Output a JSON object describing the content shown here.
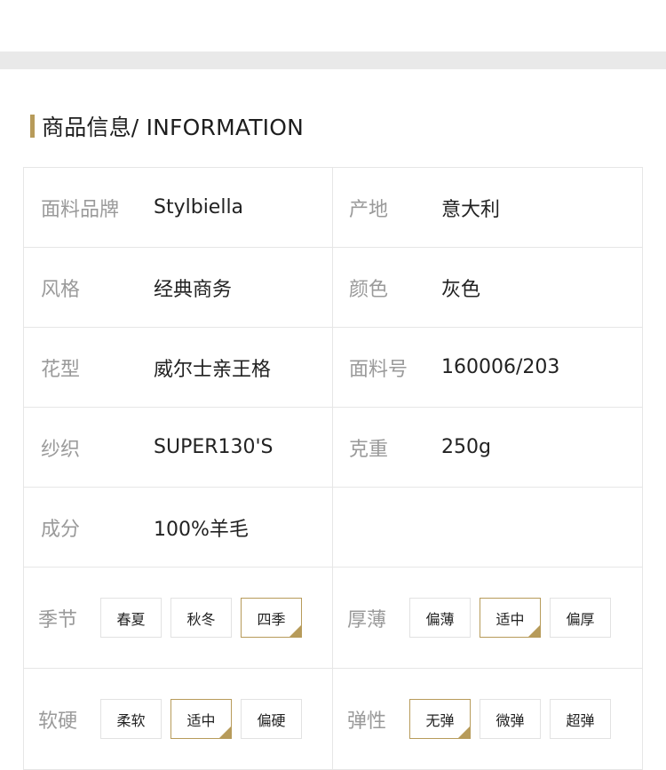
{
  "section": {
    "title": "商品信息/ INFORMATION"
  },
  "colors": {
    "accent": "#b79b5a",
    "label": "#9a9a9a",
    "border": "#e6e6e6",
    "topbar": "#e9e9e9"
  },
  "rows": [
    {
      "left": {
        "label": "面料品牌",
        "value": "Stylbiella"
      },
      "right": {
        "label": "产地",
        "value": "意大利"
      }
    },
    {
      "left": {
        "label": "风格",
        "value": "经典商务"
      },
      "right": {
        "label": "颜色",
        "value": "灰色"
      }
    },
    {
      "left": {
        "label": "花型",
        "value": "威尔士亲王格"
      },
      "right": {
        "label": "面料号",
        "value": "160006/203"
      }
    },
    {
      "left": {
        "label": "纱织",
        "value": "SUPER130'S"
      },
      "right": {
        "label": "克重",
        "value": "250g"
      }
    },
    {
      "left": {
        "label": "成分",
        "value": "100%羊毛"
      }
    }
  ],
  "options": [
    {
      "left": {
        "label": "季节",
        "choices": [
          "春夏",
          "秋冬",
          "四季"
        ],
        "selected": "四季"
      },
      "right": {
        "label": "厚薄",
        "choices": [
          "偏薄",
          "适中",
          "偏厚"
        ],
        "selected": "适中"
      }
    },
    {
      "left": {
        "label": "软硬",
        "choices": [
          "柔软",
          "适中",
          "偏硬"
        ],
        "selected": "适中"
      },
      "right": {
        "label": "弹性",
        "choices": [
          "无弹",
          "微弹",
          "超弹"
        ],
        "selected": "无弹"
      }
    }
  ]
}
